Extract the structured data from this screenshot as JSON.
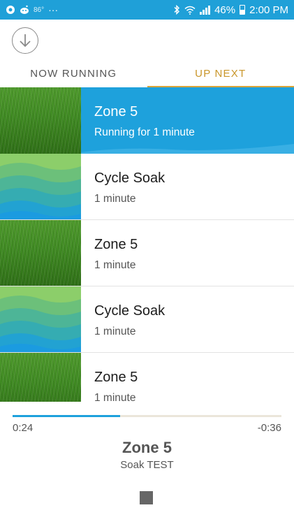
{
  "status_bar": {
    "temperature": "86°",
    "more": "···",
    "battery": "46%",
    "time": "2:00 PM"
  },
  "header": {
    "collapse_icon": "arrow-down-circle-icon"
  },
  "tabs": [
    {
      "label": "NOW RUNNING",
      "active": false
    },
    {
      "label": "UP NEXT",
      "active": true
    }
  ],
  "queue": [
    {
      "title": "Zone 5",
      "subtitle": "Running for 1 minute",
      "image": "grass",
      "current": true
    },
    {
      "title": "Cycle Soak",
      "subtitle": "1 minute",
      "image": "waves",
      "current": false
    },
    {
      "title": "Zone 5",
      "subtitle": "1 minute",
      "image": "grass",
      "current": false
    },
    {
      "title": "Cycle Soak",
      "subtitle": "1 minute",
      "image": "waves",
      "current": false
    },
    {
      "title": "Zone 5",
      "subtitle": "1 minute",
      "image": "grass",
      "current": false
    }
  ],
  "player": {
    "elapsed": "0:24",
    "remaining": "-0:36",
    "progress": 0.4,
    "title": "Zone 5",
    "subtitle": "Soak TEST",
    "stop_icon": "stop-icon"
  },
  "colors": {
    "accent_blue": "#1ea1dc",
    "tab_active": "#d9a53a",
    "grass_green": "#3f8a22"
  }
}
